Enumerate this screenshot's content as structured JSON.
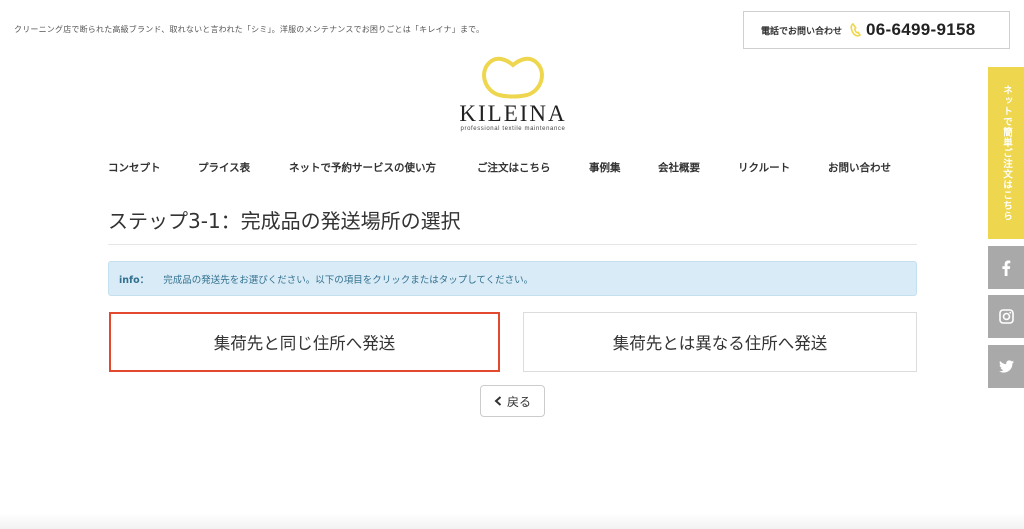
{
  "header": {
    "tagline": "クリーニング店で断られた高級ブランド、取れないと言われた「シミ」。洋服のメンテナンスでお困りごとは「キレイナ」まで。",
    "phone_label": "電話でお問い合わせ",
    "phone_number": "06-6499-9158",
    "logo_text": "KILEINA",
    "logo_subtext": "professional textile maintenance",
    "logo_color": "#eed64e"
  },
  "nav": {
    "items": [
      {
        "label": "コンセプト"
      },
      {
        "label": "プライス表"
      },
      {
        "label": "ネットで予約サービスの使い方"
      },
      {
        "label": "ご注文はこちら"
      },
      {
        "label": "事例集"
      },
      {
        "label": "会社概要"
      },
      {
        "label": "リクルート"
      },
      {
        "label": "お問い合わせ"
      }
    ]
  },
  "main": {
    "title": "ステップ3-1：完成品の発送場所の選択",
    "info_label": "info：",
    "info_text": "完成品の発送先をお選びください。以下の項目をクリックまたはタップしてください。",
    "options": [
      {
        "label": "集荷先と同じ住所へ発送",
        "selected": true
      },
      {
        "label": "集荷先とは異なる住所へ発送",
        "selected": false
      }
    ],
    "back_label": "戻る"
  },
  "sidebar": {
    "cta_label": "ネットで簡単ご注文はこちら",
    "social": [
      {
        "icon": "facebook-icon"
      },
      {
        "icon": "instagram-icon"
      },
      {
        "icon": "twitter-icon"
      }
    ]
  },
  "colors": {
    "accent_yellow": "#eed64e",
    "selected_border": "#e2492f",
    "info_bg": "#d9ebf6",
    "social_bg": "#a9a9a9"
  }
}
